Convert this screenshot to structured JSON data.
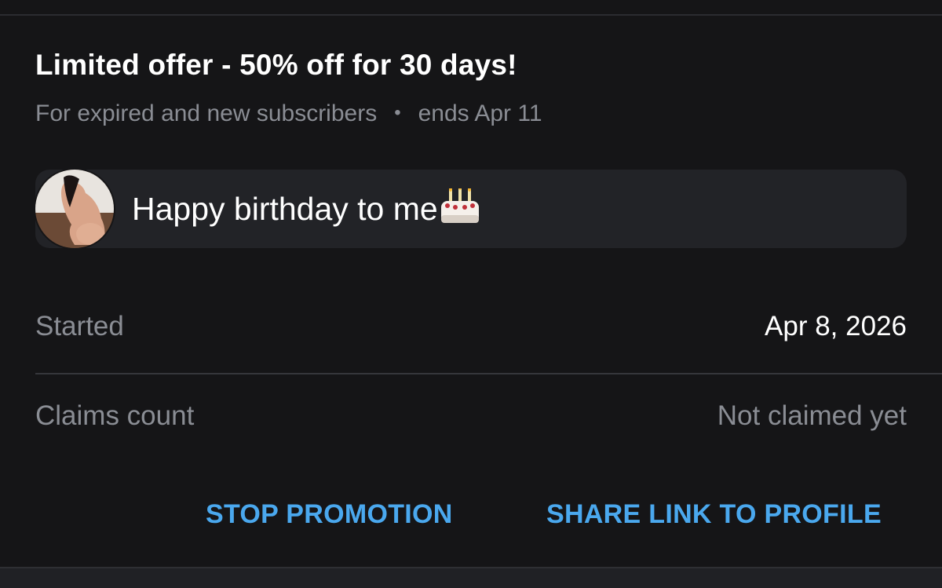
{
  "promotion": {
    "title": "Limited offer - 50% off for 30 days!",
    "audience": "For expired and new subscribers",
    "ends": "ends Apr 11"
  },
  "message": {
    "text": "Happy birthday to me",
    "emoji_icon": "birthday-cake-icon"
  },
  "details": {
    "started_label": "Started",
    "started_value": "Apr 8, 2026",
    "claims_label": "Claims count",
    "claims_value": "Not claimed yet"
  },
  "actions": {
    "stop_label": "STOP PROMOTION",
    "share_label": "SHARE LINK TO PROFILE"
  },
  "colors": {
    "background": "#151517",
    "accent": "#4aa8ee",
    "muted_text": "#8a8d94",
    "message_bg": "#222327"
  }
}
